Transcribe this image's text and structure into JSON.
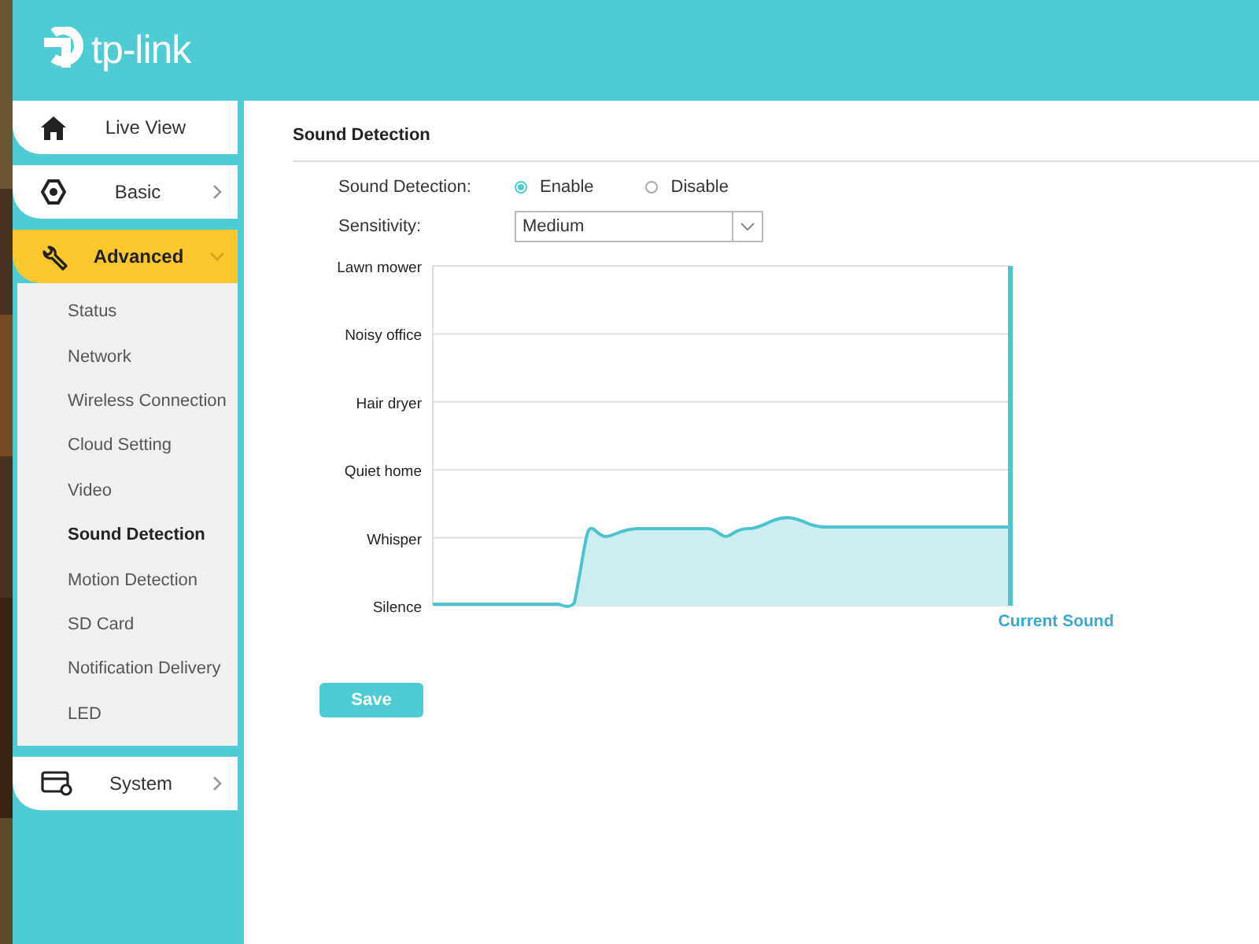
{
  "header": {
    "logo_text": "tp-link"
  },
  "sidebar": {
    "items": [
      {
        "label": "Live View",
        "kind": "link",
        "selected": false
      },
      {
        "label": "Basic",
        "kind": "menu",
        "selected": false,
        "expanded": false
      },
      {
        "label": "Advanced",
        "kind": "menu",
        "selected": true,
        "expanded": true,
        "children": [
          {
            "label": "Status",
            "selected": false
          },
          {
            "label": "Network",
            "selected": false
          },
          {
            "label": "Wireless Connection",
            "selected": false
          },
          {
            "label": "Cloud Setting",
            "selected": false
          },
          {
            "label": "Video",
            "selected": false
          },
          {
            "label": "Sound Detection",
            "selected": true
          },
          {
            "label": "Motion Detection",
            "selected": false
          },
          {
            "label": "SD Card",
            "selected": false
          },
          {
            "label": "Notification Delivery",
            "selected": false
          },
          {
            "label": "LED",
            "selected": false
          }
        ]
      },
      {
        "label": "System",
        "kind": "menu",
        "selected": false,
        "expanded": false
      }
    ]
  },
  "section": {
    "title": "Sound Detection",
    "detection": {
      "label": "Sound Detection:",
      "options": [
        {
          "label": "Enable",
          "selected": true
        },
        {
          "label": "Disable",
          "selected": false
        }
      ]
    },
    "sensitivity": {
      "label": "Sensitivity:",
      "value": "Medium"
    },
    "meter": {
      "levels": [
        "Lawn mower",
        "Noisy office",
        "Hair dryer",
        "Quiet home",
        "Whisper",
        "Silence"
      ],
      "caption": "Current Sound"
    },
    "save_button": "Save"
  }
}
